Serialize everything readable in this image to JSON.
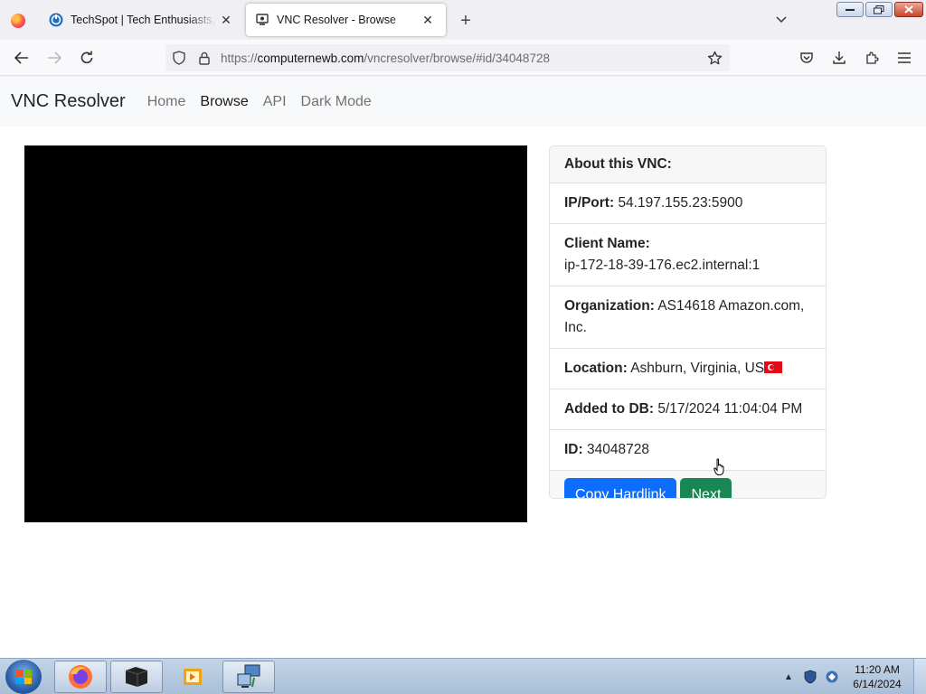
{
  "browser": {
    "tabs": [
      {
        "title": "TechSpot | Tech Enthusiasts, Power Users",
        "active": false
      },
      {
        "title": "VNC Resolver - Browse",
        "active": true
      }
    ],
    "url": {
      "scheme": "https://",
      "host": "computernewb.com",
      "path": "/vncresolver/browse/#id/34048728"
    }
  },
  "site": {
    "brand": "VNC Resolver",
    "nav": [
      {
        "label": "Home",
        "active": false
      },
      {
        "label": "Browse",
        "active": true
      },
      {
        "label": "API",
        "active": false
      },
      {
        "label": "Dark Mode",
        "active": false
      }
    ]
  },
  "vnc": {
    "header": "About this VNC:",
    "ip_port_label": "IP/Port:",
    "ip_port": "54.197.155.23:5900",
    "client_name_label": "Client Name:",
    "client_name": "ip-172-18-39-176.ec2.internal:1",
    "organization_label": "Organization:",
    "organization": "AS14618 Amazon.com, Inc.",
    "location_label": "Location:",
    "location": "Ashburn, Virginia, US",
    "added_label": "Added to DB:",
    "added": "5/17/2024 11:04:04 PM",
    "id_label": "ID:",
    "id": "34048728",
    "copy_button": "Copy Hardlink",
    "next_button": "Next"
  },
  "taskbar": {
    "time": "11:20 AM",
    "date": "6/14/2024"
  },
  "colors": {
    "primary": "#0d6efd",
    "success": "#198754",
    "flag": "#e30a17"
  }
}
